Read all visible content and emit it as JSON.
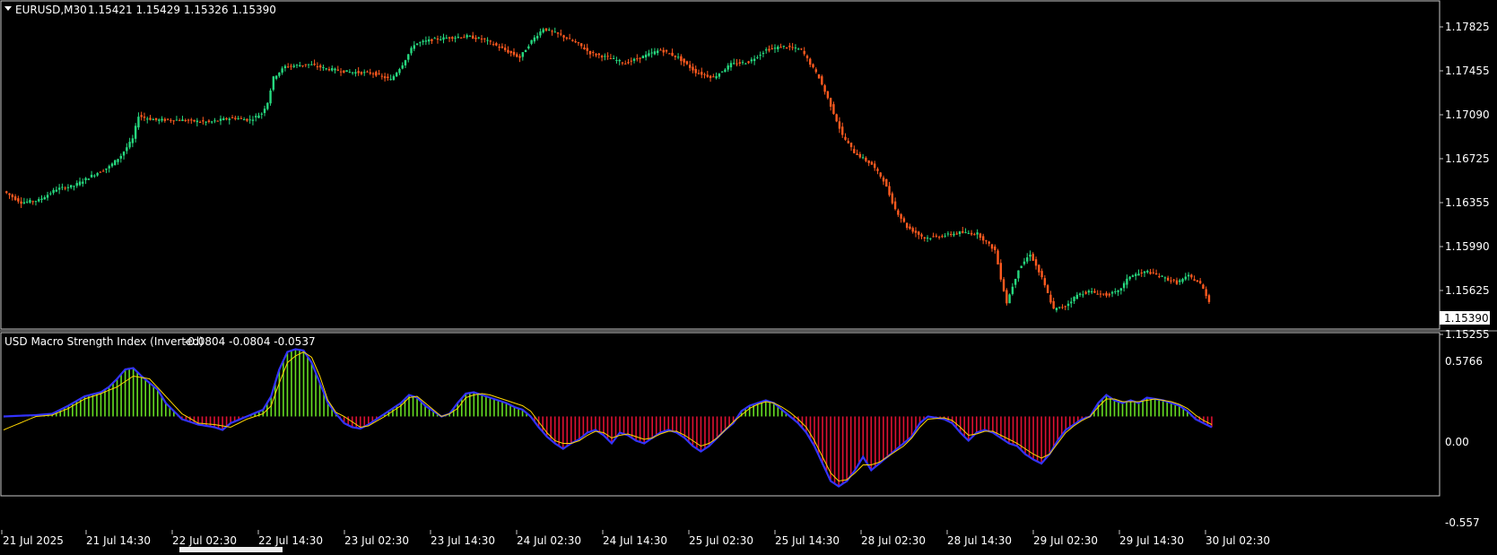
{
  "main_chart": {
    "title": "EURUSD,M30",
    "ohlc": "1.15421 1.15429 1.15326 1.15390",
    "current_price": "1.15390",
    "y_ticks": [
      "1.17825",
      "1.17455",
      "1.17090",
      "1.16725",
      "1.16355",
      "1.15990",
      "1.15625",
      "1.15255"
    ]
  },
  "indicator": {
    "title": "USD Macro Strength Index (Inverted)",
    "values": "-0.0804 -0.0804 -0.0537",
    "y_ticks": [
      "0.5766",
      "0.00",
      "-0.557"
    ]
  },
  "x_ticks": [
    "21 Jul 2025",
    "21 Jul 14:30",
    "22 Jul 02:30",
    "22 Jul 14:30",
    "23 Jul 02:30",
    "23 Jul 14:30",
    "24 Jul 02:30",
    "24 Jul 14:30",
    "25 Jul 02:30",
    "25 Jul 14:30",
    "28 Jul 02:30",
    "28 Jul 14:30",
    "29 Jul 02:30",
    "29 Jul 14:30",
    "30 Jul 02:30"
  ],
  "colors": {
    "background": "#000000",
    "frame": "#c8c8c8",
    "bull_candle": "#26d97f",
    "bear_candle": "#ff5a1f",
    "hist_positive": "#66dd22",
    "hist_negative": "#dd1133",
    "signal_line": "#ffd700",
    "outline_line": "#3333ff",
    "price_label_bg": "#ffffff"
  },
  "chart_data": [
    {
      "type": "candlestick",
      "title": "EURUSD,M30",
      "ylim": [
        1.152,
        1.18
      ],
      "close_path": [
        [
          0,
          1.1638
        ],
        [
          6,
          1.1628
        ],
        [
          12,
          1.163
        ],
        [
          18,
          1.164
        ],
        [
          24,
          1.1643
        ],
        [
          30,
          1.1652
        ],
        [
          36,
          1.166
        ],
        [
          40,
          1.167
        ],
        [
          44,
          1.1685
        ],
        [
          46,
          1.1706
        ],
        [
          48,
          1.1704
        ],
        [
          52,
          1.1702
        ],
        [
          60,
          1.1702
        ],
        [
          70,
          1.17
        ],
        [
          78,
          1.1704
        ],
        [
          84,
          1.1702
        ],
        [
          88,
          1.1708
        ],
        [
          90,
          1.1718
        ],
        [
          92,
          1.174
        ],
        [
          96,
          1.175
        ],
        [
          104,
          1.1752
        ],
        [
          110,
          1.1748
        ],
        [
          118,
          1.1745
        ],
        [
          126,
          1.1744
        ],
        [
          132,
          1.1738
        ],
        [
          136,
          1.1752
        ],
        [
          140,
          1.177
        ],
        [
          146,
          1.1774
        ],
        [
          152,
          1.1776
        ],
        [
          158,
          1.1777
        ],
        [
          164,
          1.1774
        ],
        [
          170,
          1.1766
        ],
        [
          176,
          1.1758
        ],
        [
          180,
          1.1773
        ],
        [
          184,
          1.1784
        ],
        [
          190,
          1.1778
        ],
        [
          196,
          1.177
        ],
        [
          200,
          1.1762
        ],
        [
          206,
          1.1758
        ],
        [
          212,
          1.1753
        ],
        [
          218,
          1.1759
        ],
        [
          224,
          1.1765
        ],
        [
          230,
          1.1758
        ],
        [
          236,
          1.1745
        ],
        [
          242,
          1.174
        ],
        [
          248,
          1.1752
        ],
        [
          254,
          1.1754
        ],
        [
          260,
          1.1765
        ],
        [
          266,
          1.1768
        ],
        [
          272,
          1.1765
        ],
        [
          278,
          1.174
        ],
        [
          282,
          1.1715
        ],
        [
          286,
          1.1688
        ],
        [
          290,
          1.1673
        ],
        [
          296,
          1.1662
        ],
        [
          300,
          1.1648
        ],
        [
          304,
          1.1622
        ],
        [
          308,
          1.1606
        ],
        [
          314,
          1.1596
        ],
        [
          320,
          1.1598
        ],
        [
          326,
          1.1601
        ],
        [
          332,
          1.16
        ],
        [
          338,
          1.1585
        ],
        [
          340,
          1.156
        ],
        [
          342,
          1.1538
        ],
        [
          346,
          1.1568
        ],
        [
          350,
          1.1582
        ],
        [
          354,
          1.156
        ],
        [
          358,
          1.1532
        ],
        [
          362,
          1.1535
        ],
        [
          366,
          1.1545
        ],
        [
          370,
          1.1548
        ],
        [
          376,
          1.1545
        ],
        [
          380,
          1.1548
        ],
        [
          384,
          1.1562
        ],
        [
          390,
          1.1566
        ],
        [
          396,
          1.156
        ],
        [
          400,
          1.1556
        ],
        [
          404,
          1.1562
        ],
        [
          408,
          1.1555
        ],
        [
          410,
          1.1545
        ],
        [
          411,
          1.1539
        ]
      ]
    },
    {
      "type": "bar",
      "title": "USD Macro Strength Index (Inverted)",
      "ylim": [
        -0.557,
        0.5766
      ],
      "histogram_path": [
        [
          0,
          0.0
        ],
        [
          8,
          0.01
        ],
        [
          12,
          0.02
        ],
        [
          16,
          0.08
        ],
        [
          20,
          0.15
        ],
        [
          24,
          0.18
        ],
        [
          26,
          0.22
        ],
        [
          28,
          0.28
        ],
        [
          30,
          0.35
        ],
        [
          32,
          0.36
        ],
        [
          34,
          0.3
        ],
        [
          38,
          0.2
        ],
        [
          40,
          0.1
        ],
        [
          42,
          0.04
        ],
        [
          44,
          -0.02
        ],
        [
          48,
          -0.06
        ],
        [
          52,
          -0.08
        ],
        [
          54,
          -0.1
        ],
        [
          56,
          -0.05
        ],
        [
          60,
          0.0
        ],
        [
          64,
          0.05
        ],
        [
          66,
          0.15
        ],
        [
          68,
          0.35
        ],
        [
          70,
          0.48
        ],
        [
          72,
          0.5
        ],
        [
          74,
          0.49
        ],
        [
          76,
          0.4
        ],
        [
          78,
          0.25
        ],
        [
          80,
          0.1
        ],
        [
          82,
          0.02
        ],
        [
          84,
          -0.05
        ],
        [
          86,
          -0.08
        ],
        [
          88,
          -0.09
        ],
        [
          90,
          -0.06
        ],
        [
          94,
          0.02
        ],
        [
          98,
          0.1
        ],
        [
          100,
          0.16
        ],
        [
          102,
          0.14
        ],
        [
          104,
          0.08
        ],
        [
          106,
          0.04
        ],
        [
          108,
          0.0
        ],
        [
          110,
          0.02
        ],
        [
          112,
          0.1
        ],
        [
          114,
          0.17
        ],
        [
          116,
          0.18
        ],
        [
          118,
          0.16
        ],
        [
          120,
          0.14
        ],
        [
          122,
          0.12
        ],
        [
          124,
          0.1
        ],
        [
          126,
          0.07
        ],
        [
          128,
          0.05
        ],
        [
          130,
          0.0
        ],
        [
          132,
          -0.08
        ],
        [
          134,
          -0.15
        ],
        [
          136,
          -0.2
        ],
        [
          138,
          -0.24
        ],
        [
          140,
          -0.2
        ],
        [
          142,
          -0.17
        ],
        [
          144,
          -0.12
        ],
        [
          146,
          -0.1
        ],
        [
          148,
          -0.14
        ],
        [
          150,
          -0.2
        ],
        [
          152,
          -0.12
        ],
        [
          154,
          -0.14
        ],
        [
          156,
          -0.18
        ],
        [
          158,
          -0.2
        ],
        [
          160,
          -0.16
        ],
        [
          162,
          -0.12
        ],
        [
          164,
          -0.1
        ],
        [
          166,
          -0.12
        ],
        [
          168,
          -0.16
        ],
        [
          170,
          -0.22
        ],
        [
          172,
          -0.26
        ],
        [
          174,
          -0.22
        ],
        [
          176,
          -0.16
        ],
        [
          178,
          -0.1
        ],
        [
          180,
          -0.05
        ],
        [
          182,
          0.04
        ],
        [
          184,
          0.08
        ],
        [
          186,
          0.1
        ],
        [
          188,
          0.12
        ],
        [
          190,
          0.1
        ],
        [
          192,
          0.05
        ],
        [
          194,
          0.0
        ],
        [
          196,
          -0.05
        ],
        [
          198,
          -0.12
        ],
        [
          200,
          -0.22
        ],
        [
          202,
          -0.35
        ],
        [
          204,
          -0.48
        ],
        [
          206,
          -0.52
        ],
        [
          208,
          -0.48
        ],
        [
          210,
          -0.4
        ],
        [
          212,
          -0.3
        ],
        [
          214,
          -0.4
        ],
        [
          216,
          -0.35
        ],
        [
          218,
          -0.3
        ],
        [
          220,
          -0.25
        ],
        [
          222,
          -0.2
        ],
        [
          224,
          -0.15
        ],
        [
          226,
          -0.05
        ],
        [
          228,
          0.0
        ],
        [
          232,
          -0.02
        ],
        [
          234,
          -0.05
        ],
        [
          236,
          -0.12
        ],
        [
          238,
          -0.18
        ],
        [
          240,
          -0.12
        ],
        [
          242,
          -0.1
        ],
        [
          244,
          -0.12
        ],
        [
          246,
          -0.16
        ],
        [
          248,
          -0.2
        ],
        [
          250,
          -0.22
        ],
        [
          252,
          -0.28
        ],
        [
          254,
          -0.32
        ],
        [
          256,
          -0.35
        ],
        [
          258,
          -0.28
        ],
        [
          260,
          -0.18
        ],
        [
          262,
          -0.1
        ],
        [
          264,
          -0.06
        ],
        [
          266,
          -0.02
        ],
        [
          268,
          0.0
        ],
        [
          270,
          0.1
        ],
        [
          272,
          0.16
        ],
        [
          274,
          0.12
        ],
        [
          276,
          0.1
        ],
        [
          278,
          0.12
        ],
        [
          280,
          0.1
        ],
        [
          282,
          0.14
        ],
        [
          284,
          0.13
        ],
        [
          286,
          0.12
        ],
        [
          288,
          0.1
        ],
        [
          290,
          0.08
        ],
        [
          292,
          0.04
        ],
        [
          294,
          -0.02
        ],
        [
          296,
          -0.05
        ],
        [
          298,
          -0.08
        ]
      ],
      "signal_path": [
        [
          0,
          -0.1
        ],
        [
          4,
          -0.05
        ],
        [
          8,
          0.0
        ],
        [
          12,
          0.01
        ],
        [
          16,
          0.06
        ],
        [
          20,
          0.13
        ],
        [
          24,
          0.17
        ],
        [
          28,
          0.22
        ],
        [
          32,
          0.3
        ],
        [
          36,
          0.28
        ],
        [
          40,
          0.15
        ],
        [
          44,
          0.02
        ],
        [
          48,
          -0.05
        ],
        [
          52,
          -0.06
        ],
        [
          56,
          -0.08
        ],
        [
          60,
          -0.02
        ],
        [
          64,
          0.02
        ],
        [
          66,
          0.08
        ],
        [
          68,
          0.25
        ],
        [
          70,
          0.4
        ],
        [
          72,
          0.45
        ],
        [
          74,
          0.48
        ],
        [
          76,
          0.44
        ],
        [
          78,
          0.3
        ],
        [
          80,
          0.12
        ],
        [
          82,
          0.03
        ],
        [
          84,
          0.0
        ],
        [
          86,
          -0.04
        ],
        [
          88,
          -0.08
        ],
        [
          90,
          -0.07
        ],
        [
          94,
          0.0
        ],
        [
          98,
          0.08
        ],
        [
          100,
          0.14
        ],
        [
          102,
          0.15
        ],
        [
          104,
          0.1
        ],
        [
          106,
          0.05
        ],
        [
          108,
          0.0
        ],
        [
          110,
          0.02
        ],
        [
          112,
          0.06
        ],
        [
          114,
          0.14
        ],
        [
          116,
          0.16
        ],
        [
          118,
          0.17
        ],
        [
          120,
          0.16
        ],
        [
          122,
          0.14
        ],
        [
          124,
          0.12
        ],
        [
          126,
          0.1
        ],
        [
          128,
          0.08
        ],
        [
          130,
          0.04
        ],
        [
          132,
          -0.04
        ],
        [
          134,
          -0.12
        ],
        [
          136,
          -0.18
        ],
        [
          138,
          -0.2
        ],
        [
          140,
          -0.2
        ],
        [
          142,
          -0.18
        ],
        [
          144,
          -0.14
        ],
        [
          146,
          -0.11
        ],
        [
          148,
          -0.12
        ],
        [
          150,
          -0.16
        ],
        [
          152,
          -0.14
        ],
        [
          154,
          -0.13
        ],
        [
          156,
          -0.15
        ],
        [
          158,
          -0.17
        ],
        [
          160,
          -0.16
        ],
        [
          162,
          -0.13
        ],
        [
          164,
          -0.11
        ],
        [
          166,
          -0.11
        ],
        [
          168,
          -0.14
        ],
        [
          170,
          -0.18
        ],
        [
          172,
          -0.22
        ],
        [
          174,
          -0.2
        ],
        [
          176,
          -0.16
        ],
        [
          178,
          -0.1
        ],
        [
          180,
          -0.04
        ],
        [
          182,
          0.01
        ],
        [
          184,
          0.06
        ],
        [
          186,
          0.09
        ],
        [
          188,
          0.11
        ],
        [
          190,
          0.1
        ],
        [
          192,
          0.07
        ],
        [
          194,
          0.03
        ],
        [
          196,
          -0.02
        ],
        [
          198,
          -0.08
        ],
        [
          200,
          -0.18
        ],
        [
          202,
          -0.3
        ],
        [
          204,
          -0.42
        ],
        [
          206,
          -0.48
        ],
        [
          208,
          -0.47
        ],
        [
          210,
          -0.42
        ],
        [
          212,
          -0.36
        ],
        [
          214,
          -0.36
        ],
        [
          216,
          -0.34
        ],
        [
          218,
          -0.3
        ],
        [
          220,
          -0.26
        ],
        [
          222,
          -0.22
        ],
        [
          224,
          -0.16
        ],
        [
          226,
          -0.08
        ],
        [
          228,
          -0.02
        ],
        [
          232,
          -0.01
        ],
        [
          234,
          -0.03
        ],
        [
          236,
          -0.08
        ],
        [
          238,
          -0.14
        ],
        [
          240,
          -0.13
        ],
        [
          242,
          -0.11
        ],
        [
          244,
          -0.11
        ],
        [
          246,
          -0.14
        ],
        [
          248,
          -0.17
        ],
        [
          250,
          -0.2
        ],
        [
          252,
          -0.24
        ],
        [
          254,
          -0.28
        ],
        [
          256,
          -0.31
        ],
        [
          258,
          -0.28
        ],
        [
          260,
          -0.2
        ],
        [
          262,
          -0.12
        ],
        [
          264,
          -0.07
        ],
        [
          266,
          -0.03
        ],
        [
          268,
          0.0
        ],
        [
          270,
          0.07
        ],
        [
          272,
          0.13
        ],
        [
          274,
          0.13
        ],
        [
          276,
          0.11
        ],
        [
          278,
          0.11
        ],
        [
          280,
          0.11
        ],
        [
          282,
          0.12
        ],
        [
          284,
          0.13
        ],
        [
          286,
          0.12
        ],
        [
          288,
          0.11
        ],
        [
          290,
          0.09
        ],
        [
          292,
          0.06
        ],
        [
          294,
          0.01
        ],
        [
          296,
          -0.03
        ],
        [
          298,
          -0.06
        ]
      ]
    }
  ]
}
